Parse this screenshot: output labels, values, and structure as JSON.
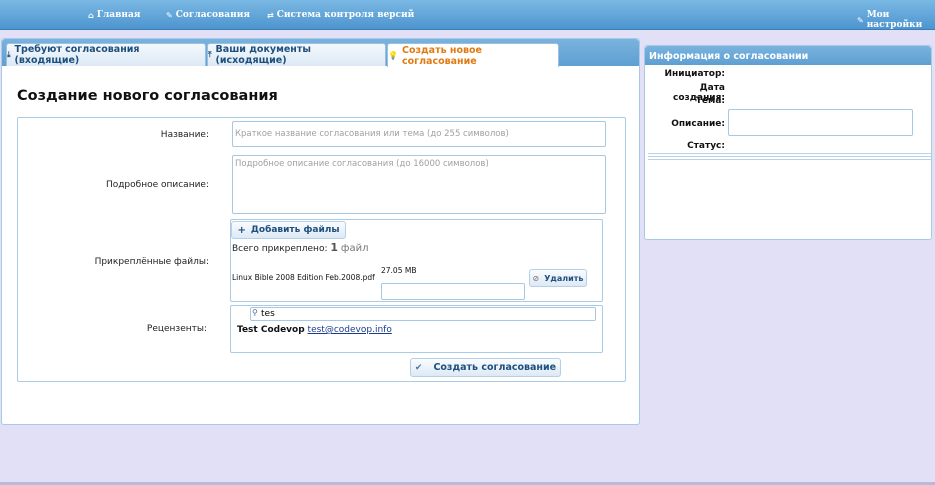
{
  "nav": {
    "home": "Главная",
    "approvals": "Согласования",
    "vcs": "Система контроля версий",
    "settings": "Мои настройки"
  },
  "tabs": [
    {
      "label": "Требуют согласования (входящие)",
      "active": false
    },
    {
      "label": "Ваши документы (исходящие)",
      "active": false
    },
    {
      "label": "Создать новое согласование",
      "active": true
    }
  ],
  "page_title": "Создание нового согласования",
  "form": {
    "name_label": "Название:",
    "name_placeholder": "Краткое название согласования или тема (до 255 символов)",
    "description_label": "Подробное описание:",
    "description_placeholder": "Подробное описание согласования (до 16000 символов)",
    "files_label": "Прикреплённые файлы:",
    "add_files": "Добавить файлы",
    "total_attached_prefix": "Всего прикреплено:",
    "total_count": "1",
    "total_unit": "файл",
    "files": [
      {
        "name": "Linux Bible 2008 Edition Feb.2008.pdf",
        "size": "27.05 MB",
        "comment": ""
      }
    ],
    "delete_label": "Удалить",
    "reviewers_label": "Рецензенты:",
    "reviewer_search_value": "tes",
    "reviewers": [
      {
        "name": "Test Codevop",
        "email": "test@codevop.info"
      }
    ],
    "submit": "Создать согласование"
  },
  "info": {
    "header": "Информация о согласовании",
    "initiator_label": "Инициатор:",
    "created_label": "Дата создания:",
    "topic_label": "Тема:",
    "description_label": "Описание:",
    "status_label": "Статус:"
  },
  "colors": {
    "accent": "#5f9fd2",
    "active_tab_text": "#e07a12",
    "page_bg": "#e2e0f6"
  }
}
